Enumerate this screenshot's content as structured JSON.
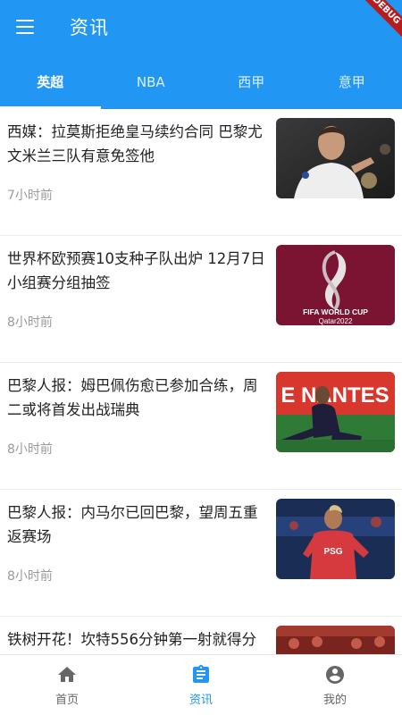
{
  "appbar": {
    "title": "资讯",
    "menu_icon": "menu-icon",
    "debug_banner": "DEBUG"
  },
  "tabs": [
    {
      "label": "英超",
      "active": true
    },
    {
      "label": "NBA",
      "active": false
    },
    {
      "label": "西甲",
      "active": false
    },
    {
      "label": "意甲",
      "active": false
    }
  ],
  "news": [
    {
      "title": "西媒：拉莫斯拒绝皇马续约合同 巴黎尤文米兰三队有意免签他",
      "time": "7小时前"
    },
    {
      "title": "世界杯欧预赛10支种子队出炉 12月7日小组赛分组抽签",
      "time": "8小时前",
      "image_text": [
        "FIFA WORLD CUP",
        "Qatar2022"
      ]
    },
    {
      "title": "巴黎人报：姆巴佩伤愈已参加合练，周二或将首发出战瑞典",
      "time": "8小时前",
      "image_text": "E NANTES"
    },
    {
      "title": "巴黎人报：内马尔已回巴黎，望周五重返赛场",
      "time": "8小时前",
      "image_text": "PSG"
    },
    {
      "title": "铁树开花！坎特556分钟第一射就得分",
      "time": ""
    }
  ],
  "bottom_nav": [
    {
      "label": "首页",
      "icon": "home-icon",
      "active": false
    },
    {
      "label": "资讯",
      "icon": "clipboard-icon",
      "active": true
    },
    {
      "label": "我的",
      "icon": "account-circle-icon",
      "active": false
    }
  ],
  "colors": {
    "primary": "#2196f3",
    "debug_ribbon": "#b71c1c",
    "text": "#222222",
    "muted": "#9a9a9a"
  }
}
